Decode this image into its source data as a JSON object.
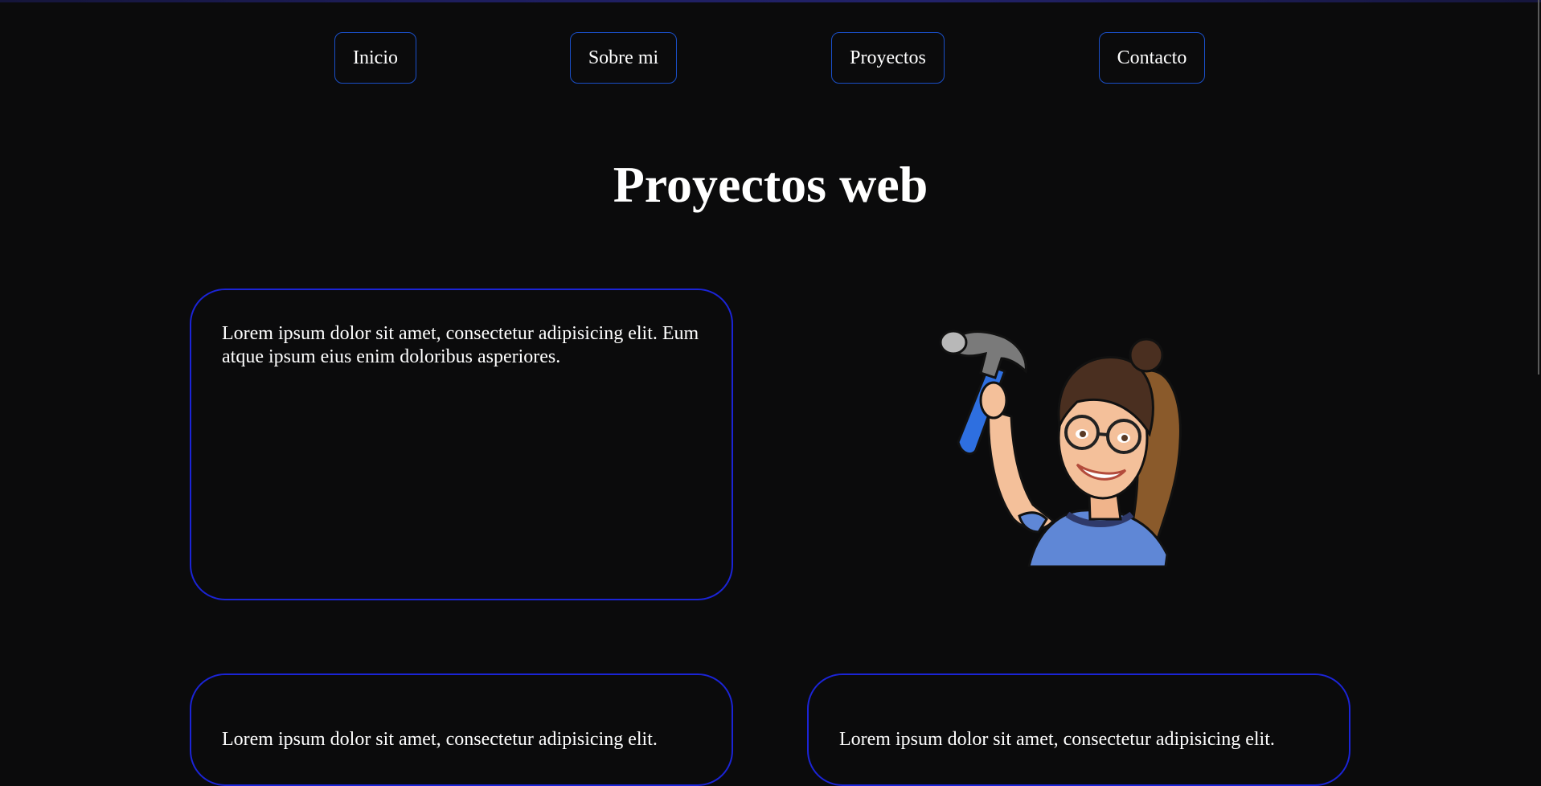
{
  "nav": {
    "items": [
      {
        "label": "Inicio"
      },
      {
        "label": "Sobre mi"
      },
      {
        "label": "Proyectos"
      },
      {
        "label": "Contacto"
      }
    ]
  },
  "main": {
    "title": "Proyectos web",
    "cards": [
      {
        "text": "Lorem ipsum dolor sit amet, consectetur adipisicing elit. Eum atque ipsum eius enim doloribus asperiores."
      },
      {
        "text": "Lorem ipsum dolor sit amet, consectetur adipisicing elit."
      },
      {
        "text": "Lorem ipsum dolor sit amet, consectetur adipisicing elit."
      }
    ]
  },
  "colors": {
    "background": "#0b0b0c",
    "card_border": "#1b24d6",
    "nav_border": "#1a4fc8",
    "text": "#ffffff"
  },
  "icons": {
    "avatar": "avatar-with-hammer-icon"
  }
}
